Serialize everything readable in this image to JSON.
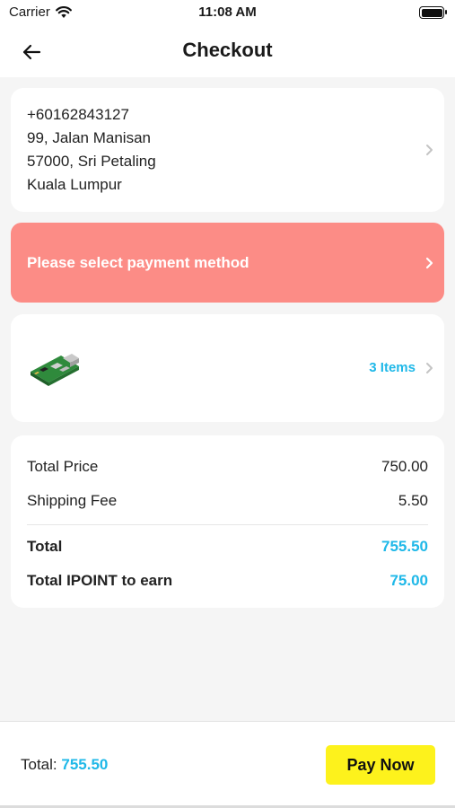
{
  "status": {
    "carrier": "Carrier",
    "time": "11:08 AM"
  },
  "nav": {
    "title": "Checkout"
  },
  "address": {
    "phone": "+60162843127",
    "line1": "99, Jalan Manisan",
    "line2": "57000, Sri Petaling",
    "line3": "Kuala Lumpur"
  },
  "payment": {
    "prompt": "Please select payment method"
  },
  "items": {
    "count_label": "3 Items"
  },
  "summary": {
    "total_price_label": "Total Price",
    "total_price_value": "750.00",
    "shipping_label": "Shipping Fee",
    "shipping_value": "5.50",
    "total_label": "Total",
    "total_value": "755.50",
    "ipoint_label": "Total IPOINT to earn",
    "ipoint_value": "75.00"
  },
  "bottom": {
    "total_label": "Total:",
    "total_value": "755.50",
    "pay_label": "Pay Now"
  },
  "colors": {
    "accent": "#1fb8e8",
    "payment_bg": "#fc8c86",
    "pay_button": "#fdf21c"
  }
}
